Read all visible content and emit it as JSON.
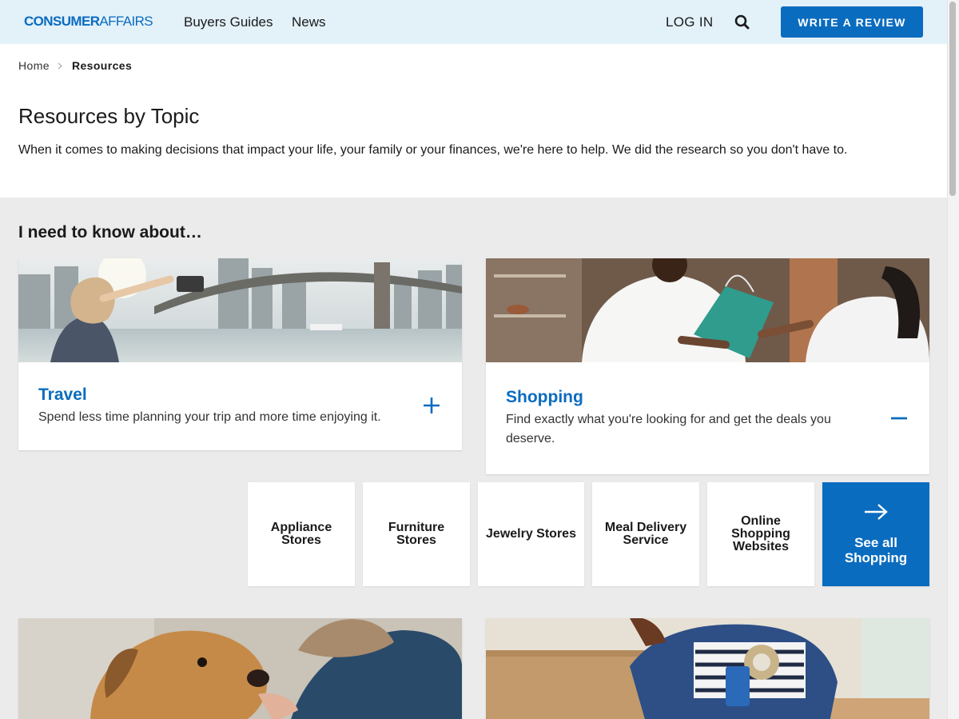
{
  "header": {
    "logo_part1": "CONSUMER",
    "logo_part2": "AFFAIRS",
    "nav": [
      "Buyers Guides",
      "News"
    ],
    "login": "LOG IN",
    "write_review": "WRITE A REVIEW"
  },
  "breadcrumb": {
    "home": "Home",
    "current": "Resources"
  },
  "hero": {
    "title": "Resources by Topic",
    "description": "When it comes to making decisions that impact your life, your family or your finances, we're here to help. We did the research so you don't have to."
  },
  "section": {
    "heading": "I need to know about…"
  },
  "topics": [
    {
      "title": "Travel",
      "description": "Spend less time planning your trip and more time enjoying it.",
      "state": "collapsed",
      "image": "travel-photo"
    },
    {
      "title": "Shopping",
      "description": "Find exactly what you're looking for and get the deals you deserve.",
      "state": "expanded",
      "image": "shopping-photo"
    },
    {
      "title": "",
      "description": "",
      "image": "pets-photo"
    },
    {
      "title": "",
      "description": "",
      "image": "moving-photo"
    }
  ],
  "shopping_subtopics": [
    "Appliance Stores",
    "Furniture Stores",
    "Jewelry Stores",
    "Meal Delivery Service",
    "Online Shopping Websites"
  ],
  "see_all": "See all Shopping",
  "colors": {
    "brand_blue": "#0a6cbf",
    "header_bg": "#e3f1f9",
    "section_bg": "#ebebeb"
  }
}
